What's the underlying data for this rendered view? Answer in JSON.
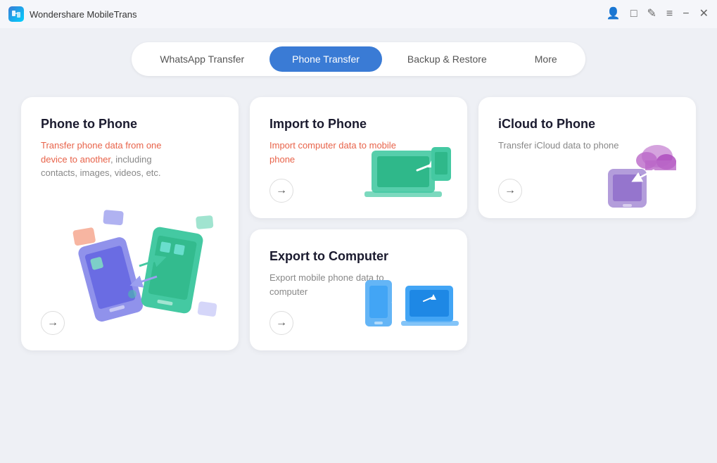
{
  "app": {
    "name": "Wondershare MobileTrans",
    "icon": "W"
  },
  "titlebar": {
    "controls": [
      "account-icon",
      "bookmark-icon",
      "edit-icon",
      "menu-icon",
      "minimize-icon",
      "close-icon"
    ]
  },
  "tabs": [
    {
      "id": "whatsapp",
      "label": "WhatsApp Transfer",
      "active": false
    },
    {
      "id": "phone",
      "label": "Phone Transfer",
      "active": true
    },
    {
      "id": "backup",
      "label": "Backup & Restore",
      "active": false
    },
    {
      "id": "more",
      "label": "More",
      "active": false
    }
  ],
  "cards": [
    {
      "id": "phone-to-phone",
      "title": "Phone to Phone",
      "description": "Transfer phone data from one device to another, including contacts, images, videos, etc.",
      "description_accent": false,
      "size": "large"
    },
    {
      "id": "import-to-phone",
      "title": "Import to Phone",
      "description": "Import computer data to mobile phone",
      "description_accent": true,
      "size": "normal"
    },
    {
      "id": "icloud-to-phone",
      "title": "iCloud to Phone",
      "description": "Transfer iCloud data to phone",
      "description_accent": false,
      "size": "normal"
    },
    {
      "id": "export-to-computer",
      "title": "Export to Computer",
      "description": "Export mobile phone data to computer",
      "description_accent": false,
      "size": "normal"
    }
  ],
  "arrow": "→"
}
